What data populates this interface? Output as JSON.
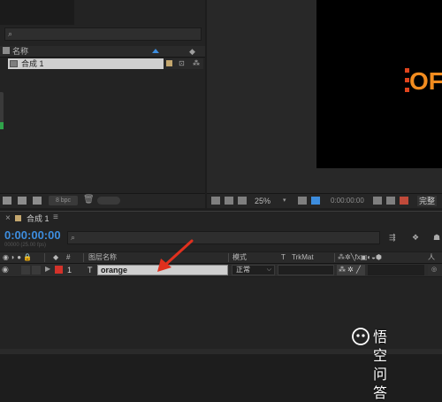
{
  "project_panel": {
    "search_icon": "search-icon",
    "column_name": "名称",
    "items": [
      {
        "name": "合成 1",
        "type_icon": "composition-icon",
        "label_color": "#c4a76e"
      }
    ],
    "bpc": "8 bpc"
  },
  "viewer": {
    "overlay_text": "OF",
    "zoom": "25%",
    "timecode": "0:00:00:00",
    "resolution": "完整"
  },
  "timeline": {
    "tab_close": "×",
    "tab_title": "合成 1",
    "tab_menu": "≡",
    "current_time": "0:00:00:00",
    "fps_label": "00000 (25.00 fps)",
    "columns": {
      "number": "#",
      "layer_name": "图层名称",
      "mode": "模式",
      "t": "T",
      "trkmat": "TrkMat"
    },
    "layers": [
      {
        "number": "1",
        "type": "T",
        "name": "orange",
        "mode": "正常",
        "label_color": "#d4322a"
      }
    ]
  },
  "watermark": {
    "text": "悟空问答"
  },
  "colors": {
    "accent_blue": "#3d8dde",
    "text_orange": "#f28c1f",
    "label_red": "#d4322a",
    "annotation_arrow": "#e0301e"
  }
}
